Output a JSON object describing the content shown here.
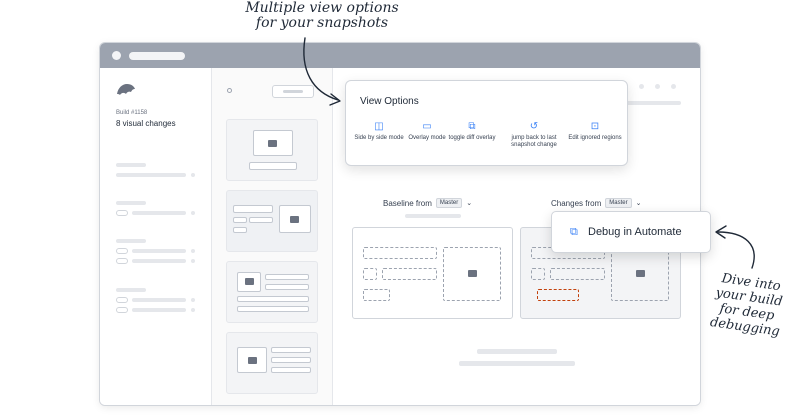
{
  "annotations": {
    "top_note": "Multiple view options\nfor your snapshots",
    "side_note": "Dive into\nyour build\nfor deep\ndebugging"
  },
  "sidebar": {
    "build_number": "Build #1158",
    "visual_changes": "8 visual changes"
  },
  "view_options": {
    "title": "View Options",
    "items": [
      {
        "label": "Side by side mode",
        "icon": "side-by-side-icon"
      },
      {
        "label": "Overlay mode",
        "icon": "overlay-icon"
      },
      {
        "label": "toggle diff overlay",
        "icon": "diff-toggle-icon"
      },
      {
        "label": "jump back to last snapshot change",
        "icon": "history-icon"
      },
      {
        "label": "Edit ignored regions",
        "icon": "ignored-regions-icon"
      }
    ]
  },
  "compare": {
    "baseline_label": "Baseline from",
    "baseline_branch": "Master",
    "changes_label": "Changes from",
    "changes_branch": "Master"
  },
  "debug": {
    "label": "Debug in Automate",
    "icon": "external-link-icon"
  },
  "colors": {
    "accent": "#3b82f6",
    "titlebar": "#9ca3af",
    "diff_highlight": "#c2410c"
  }
}
